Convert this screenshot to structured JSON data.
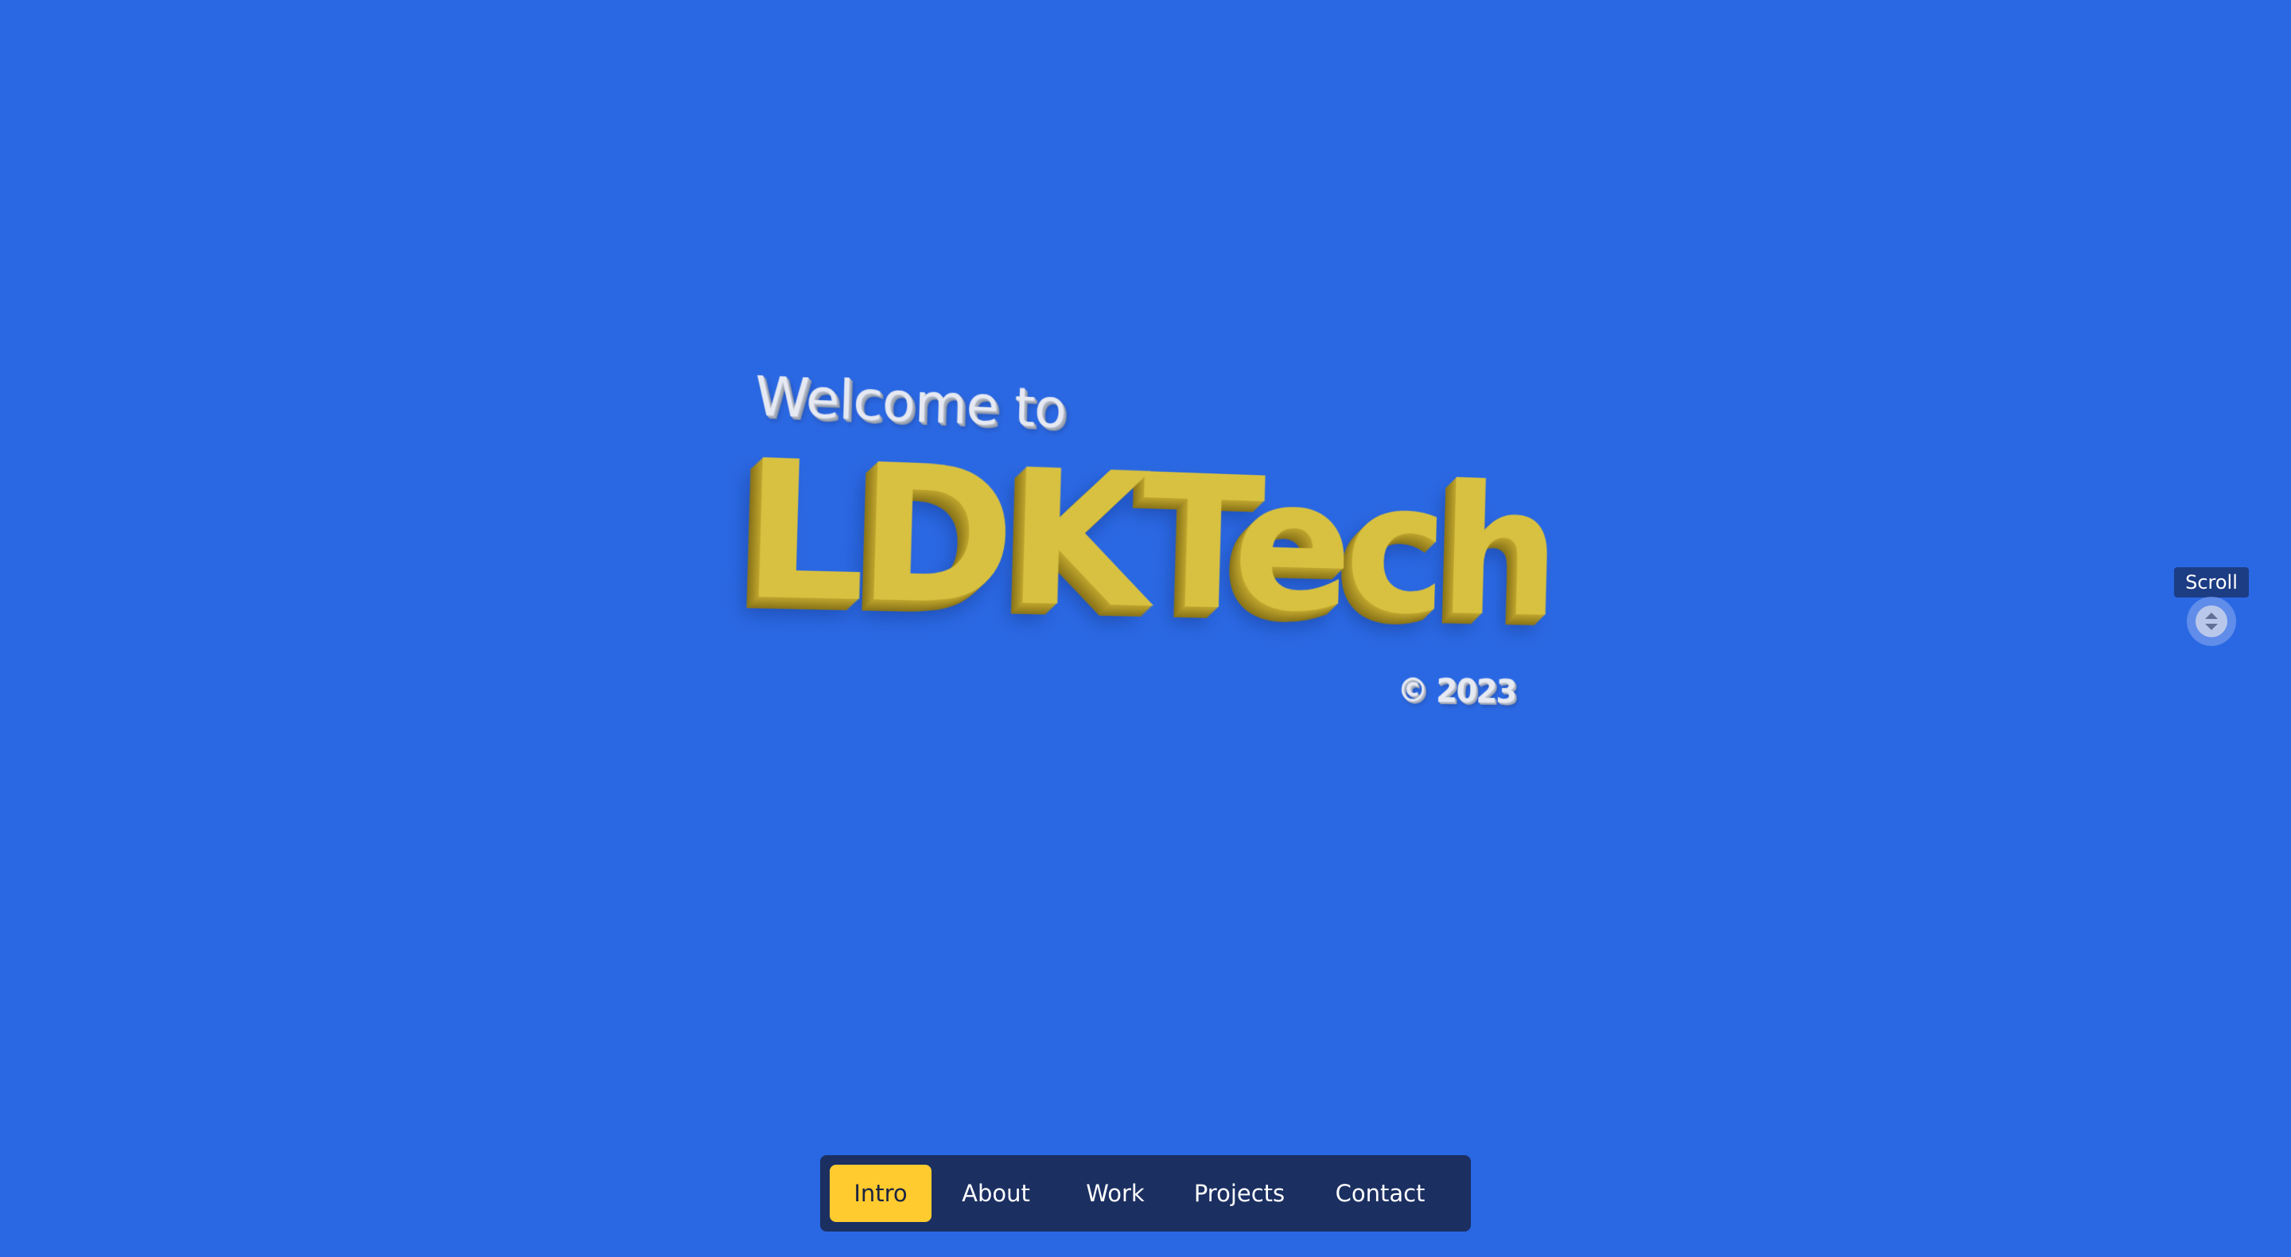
{
  "hero": {
    "welcome": "Welcome to",
    "brand": "LDKTech",
    "copyright": "© 2023"
  },
  "scroll": {
    "label": "Scroll",
    "icon": "up-down-chevron-icon"
  },
  "nav": {
    "items": [
      {
        "label": "Intro",
        "active": true
      },
      {
        "label": "About",
        "active": false
      },
      {
        "label": "Work",
        "active": false
      },
      {
        "label": "Projects",
        "active": false
      },
      {
        "label": "Contact",
        "active": false
      }
    ]
  },
  "colors": {
    "background": "#2a68e3",
    "brand_yellow": "#d8c140",
    "nav_background": "#1b2f61",
    "nav_active": "#ffcb2f",
    "scroll_label_bg": "#1c3c84"
  }
}
